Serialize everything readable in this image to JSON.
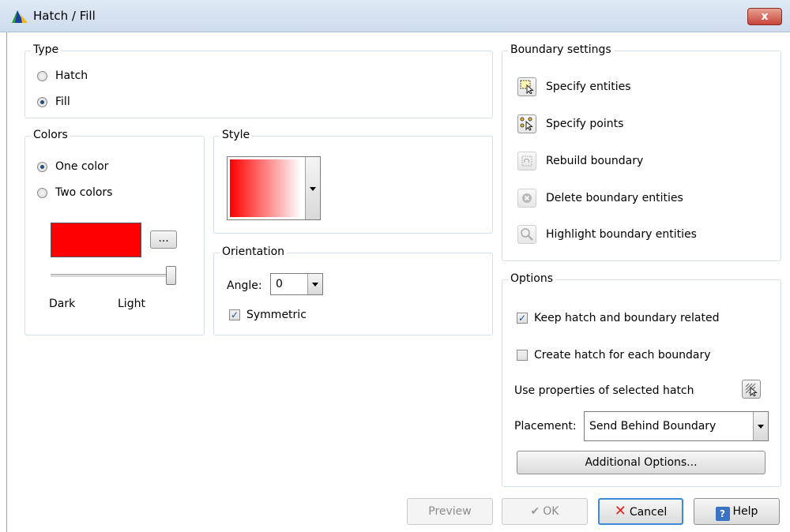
{
  "window": {
    "title": "Hatch / Fill",
    "close_label": "x"
  },
  "type_group": {
    "label": "Type",
    "options": [
      {
        "label": "Hatch",
        "selected": false
      },
      {
        "label": "Fill",
        "selected": true
      }
    ]
  },
  "colors_group": {
    "label": "Colors",
    "options": [
      {
        "label": "One color",
        "selected": true
      },
      {
        "label": "Two colors",
        "selected": false
      }
    ],
    "swatch_color": "#ff0000",
    "browse_label": "...",
    "slider_value": 1.0,
    "dark_label": "Dark",
    "light_label": "Light"
  },
  "style_group": {
    "label": "Style",
    "gradient_from": "#ff0000",
    "gradient_to": "#ffffff"
  },
  "orientation_group": {
    "label": "Orientation",
    "angle_label": "Angle:",
    "angle_value": "0",
    "symmetric_label": "Symmetric",
    "symmetric_checked": true
  },
  "boundary_group": {
    "label": "Boundary settings",
    "items": [
      {
        "label": "Specify entities",
        "icon": "select-entities-icon",
        "enabled": true
      },
      {
        "label": "Specify points",
        "icon": "select-points-icon",
        "enabled": true
      },
      {
        "label": "Rebuild boundary",
        "icon": "rebuild-boundary-icon",
        "enabled": false
      },
      {
        "label": "Delete boundary entities",
        "icon": "delete-boundary-icon",
        "enabled": false
      },
      {
        "label": "Highlight boundary entities",
        "icon": "magnifier-icon",
        "enabled": false
      }
    ]
  },
  "options_group": {
    "label": "Options",
    "keep_related_label": "Keep hatch and boundary related",
    "keep_related_checked": true,
    "create_each_label": "Create hatch for each boundary",
    "create_each_checked": false,
    "use_props_label": "Use properties of selected hatch",
    "placement_label": "Placement:",
    "placement_value": "Send Behind Boundary",
    "additional_label": "Additional Options..."
  },
  "footer": {
    "preview_label": "Preview",
    "ok_label": "OK",
    "cancel_label": "Cancel",
    "help_label": "Help"
  }
}
